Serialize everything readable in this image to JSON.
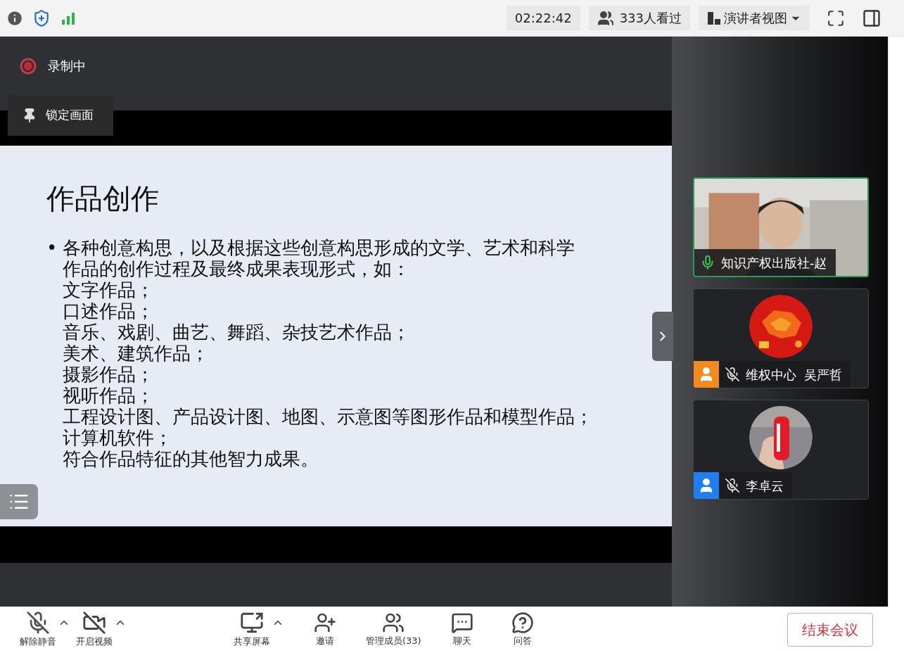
{
  "top_bar": {
    "timer": "02:22:42",
    "viewers": "333人看过",
    "view_mode": "演讲者视图"
  },
  "overlay": {
    "recording": "录制中",
    "lock": "锁定画面"
  },
  "slide": {
    "title": "作品创作",
    "bullet": "•",
    "intro": "各种创意构思，以及根据这些创意构思形成的文学、艺术和科学作品的创作过程及最终成果表现形式，如：",
    "lines": [
      "文字作品；",
      "口述作品；",
      "音乐、戏剧、曲艺、舞蹈、杂技艺术作品；",
      "美术、建筑作品；",
      "摄影作品；",
      "视听作品；",
      "工程设计图、产品设计图、地图、示意图等图形作品和模型作品；",
      "计算机软件；",
      "符合作品特征的其他智力成果。"
    ]
  },
  "participants": [
    {
      "name": "知识产权出版社-赵",
      "kind": "video",
      "muted": false,
      "speaking": true
    },
    {
      "name": "维权中心  吴严哲",
      "kind": "avatar",
      "muted": true,
      "speaking": false,
      "color": "#f28a1e"
    },
    {
      "name": "李卓云",
      "kind": "avatar",
      "muted": true,
      "speaking": false,
      "color": "#1e7ef2"
    }
  ],
  "toolbar": [
    {
      "label": "解除静音",
      "kind": "mic",
      "caret": true
    },
    {
      "label": "开启视频",
      "kind": "camera",
      "caret": true
    },
    {
      "label": "共享屏幕",
      "kind": "share",
      "caret": true
    },
    {
      "label": "邀请",
      "kind": "invite",
      "caret": false
    },
    {
      "label": "管理成员(33)",
      "kind": "members",
      "caret": false
    },
    {
      "label": "聊天",
      "kind": "chat",
      "caret": false
    },
    {
      "label": "问答",
      "kind": "qa",
      "caret": false
    }
  ],
  "end_button": "结束会议"
}
